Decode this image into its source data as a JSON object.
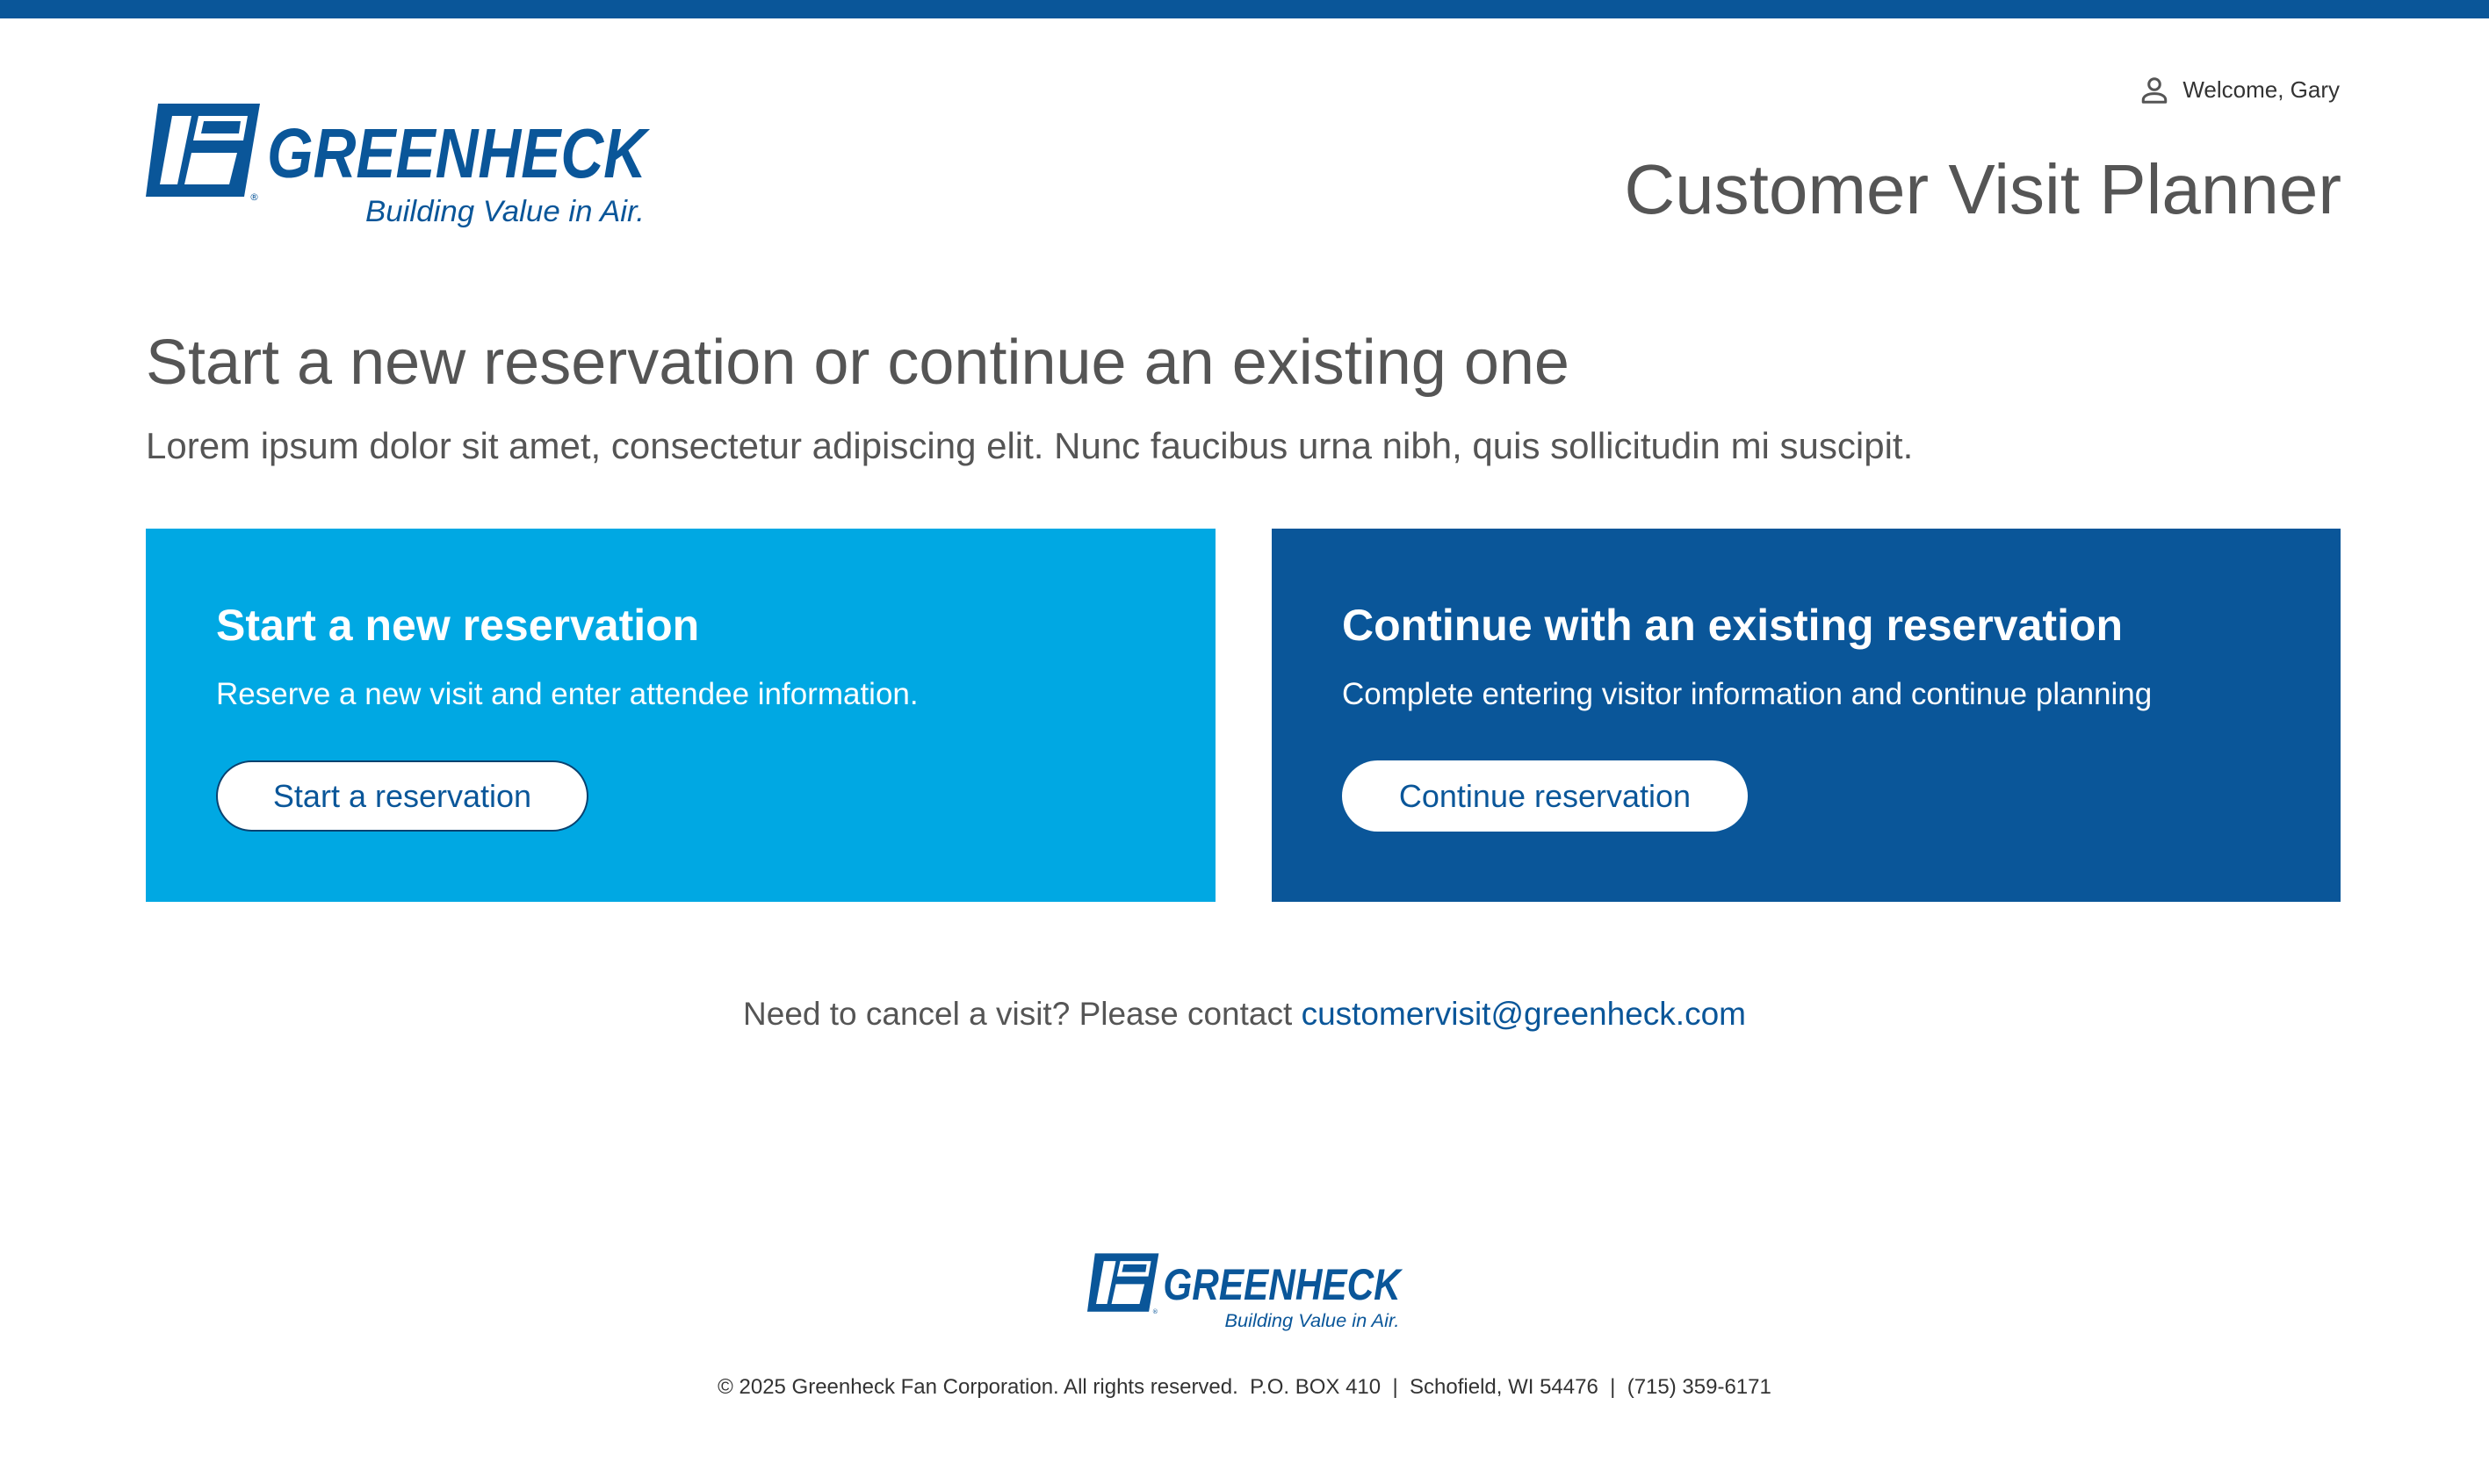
{
  "header": {
    "logo": {
      "icon": "greenheck-logo",
      "wordmark": "GREENHECK",
      "tagline": "Building Value in Air.",
      "registered": "®"
    },
    "welcome_icon": "user-icon",
    "welcome_text": "Welcome, Gary",
    "app_title": "Customer Visit Planner"
  },
  "intro": {
    "heading": "Start a new reservation or continue an existing one",
    "text": "Lorem ipsum dolor sit amet, consectetur adipiscing elit. Nunc faucibus urna nibh, quis sollicitudin mi suscipit."
  },
  "cards": {
    "new": {
      "title": "Start a new reservation",
      "description": "Reserve a new visit and enter attendee information.",
      "button": "Start a reservation"
    },
    "existing": {
      "title": "Continue with an existing reservation",
      "description": "Complete entering visitor information and continue planning",
      "button": "Continue reservation"
    }
  },
  "cancel": {
    "text": "Need to cancel a visit? Please contact ",
    "email": "customervisit@greenheck.com"
  },
  "footer": {
    "logo": {
      "wordmark": "GREENHECK",
      "tagline": "Building Value in Air.",
      "registered": "®"
    },
    "copyright": "© 2025 Greenheck Fan Corporation. All rights reserved.  P.O. BOX 410  |  Schofield, WI 54476  |  (715) 359-6171"
  },
  "colors": {
    "brand_blue": "#0a5699",
    "light_blue": "#00a8e3",
    "text_gray": "#555555"
  }
}
